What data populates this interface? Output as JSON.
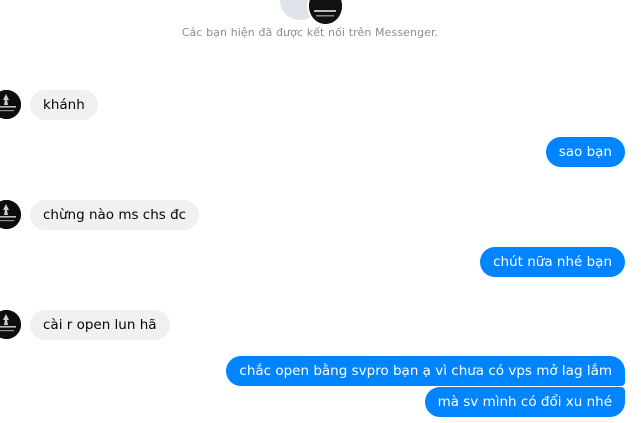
{
  "header": {
    "connected_text": "Các bạn hiện đã được kết nối trên Messenger."
  },
  "messages": [
    {
      "direction": "incoming",
      "text": "khánh"
    },
    {
      "direction": "outgoing",
      "text": "sao bạn"
    },
    {
      "direction": "incoming",
      "text": "chừng nào ms chs đc"
    },
    {
      "direction": "outgoing",
      "text": "chút nữa nhé bạn"
    },
    {
      "direction": "incoming",
      "text": "cài r open lun hã"
    },
    {
      "direction": "outgoing",
      "text": "chắc open bằng svpro bạn ạ vì chưa có vps mở lag lắm"
    },
    {
      "direction": "outgoing",
      "text": "mà sv mình có đổi xu nhé"
    }
  ],
  "colors": {
    "outgoing_bubble": "#0084ff",
    "incoming_bubble": "#f0f0f0",
    "meta_text": "#8a8d91"
  },
  "icons": {
    "contact_avatar": "contact-avatar-icon",
    "header_avatar": "header-avatar-icon"
  }
}
